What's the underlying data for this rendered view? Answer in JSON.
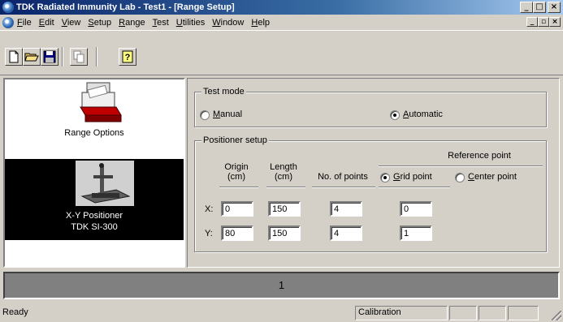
{
  "window": {
    "title": "TDK Radiated Immunity Lab - Test1 - [Range Setup]",
    "controls": [
      "_",
      "□",
      "×"
    ],
    "mdi_controls": [
      "_",
      "▫",
      "×"
    ]
  },
  "menu": [
    "File",
    "Edit",
    "View",
    "Setup",
    "Range",
    "Test",
    "Utilities",
    "Window",
    "Help"
  ],
  "toolbar": {
    "buttons": [
      "new-file",
      "open-folder",
      "save-disk",
      "copy",
      "help-question"
    ],
    "help_glyph": "?"
  },
  "left_panel": {
    "items": [
      {
        "label": "Range Options",
        "icon": "printer-range-icon"
      },
      {
        "label_line1": "X-Y Positioner",
        "label_line2": "TDK SI-300",
        "icon": "xy-positioner-icon"
      }
    ]
  },
  "test_mode": {
    "title": "Test mode",
    "options": [
      {
        "label": "Manual",
        "checked": false
      },
      {
        "label": "Automatic",
        "checked": true
      }
    ]
  },
  "positioner_setup": {
    "title": "Positioner setup",
    "reference_point_title": "Reference point",
    "columns": {
      "origin": "Origin\n(cm)",
      "length": "Length\n(cm)",
      "points": "No. of points"
    },
    "reference_options": [
      {
        "label": "Grid point",
        "checked": true
      },
      {
        "label": "Center point",
        "checked": false
      }
    ],
    "rows": [
      {
        "label": "X:",
        "origin": "0",
        "length": "150",
        "points": "4",
        "reference": "0"
      },
      {
        "label": "Y:",
        "origin": "80",
        "length": "150",
        "points": "4",
        "reference": "1"
      }
    ]
  },
  "progress": {
    "text": "1"
  },
  "status": {
    "text": "Ready",
    "panes": [
      "Calibration",
      "",
      "",
      ""
    ]
  }
}
